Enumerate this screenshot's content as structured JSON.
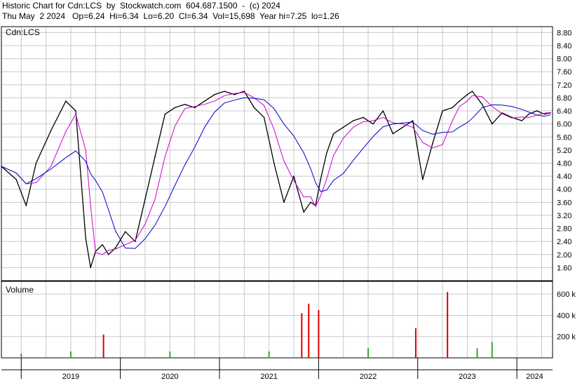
{
  "header": {
    "line1": "Historic Chart for Cdn:LCS  by  Stockwatch.com  604.687.1500  -  (c) 2024",
    "line2": "Thu May  2 2024   Op=6.24  Hi=6.34  Lo=6.20  Cl=6.34  Vol=15,698  Year hi=7.25  lo=1.26"
  },
  "price_panel": {
    "label": "Cdn:LCS",
    "ticks": [
      "8.80",
      "8.40",
      "8.00",
      "7.60",
      "7.20",
      "6.80",
      "6.40",
      "6.00",
      "5.60",
      "5.20",
      "4.80",
      "4.40",
      "4.00",
      "3.60",
      "3.20",
      "2.80",
      "2.40",
      "2.00",
      "1.60"
    ]
  },
  "volume_panel": {
    "label": "Volume",
    "ticks": [
      "600 k",
      "400 k",
      "200 k"
    ]
  },
  "x_axis": {
    "years": [
      "2019",
      "2020",
      "2021",
      "2022",
      "2023",
      "2024"
    ]
  },
  "colors": {
    "price": "#000000",
    "ma_short": "#cc00cc",
    "ma_long": "#0000cc",
    "vol_up": "#33aa33",
    "vol_down": "#dd0000",
    "grid": "#c8c8c8"
  },
  "chart_data": {
    "type": "line",
    "title": "Historic Chart for Cdn:LCS",
    "xlabel": "",
    "ylabel": "",
    "ylim": [
      1.26,
      8.9
    ],
    "x": [
      2018.8,
      2018.95,
      2019.05,
      2019.15,
      2019.3,
      2019.45,
      2019.55,
      2019.65,
      2019.7,
      2019.75,
      2019.82,
      2019.88,
      2019.95,
      2020.05,
      2020.15,
      2020.25,
      2020.35,
      2020.45,
      2020.55,
      2020.65,
      2020.75,
      2020.85,
      2020.95,
      2021.05,
      2021.15,
      2021.25,
      2021.35,
      2021.45,
      2021.55,
      2021.65,
      2021.75,
      2021.85,
      2021.92,
      2021.97,
      2022.02,
      2022.08,
      2022.15,
      2022.25,
      2022.35,
      2022.45,
      2022.55,
      2022.65,
      2022.75,
      2022.85,
      2022.95,
      2023.05,
      2023.15,
      2023.25,
      2023.35,
      2023.42,
      2023.5,
      2023.55,
      2023.65,
      2023.75,
      2023.85,
      2023.95,
      2024.05,
      2024.12,
      2024.2,
      2024.28,
      2024.34
    ],
    "series": [
      {
        "name": "",
        "values": [
          4.7,
          4.3,
          3.5,
          4.8,
          5.8,
          6.7,
          6.4,
          2.5,
          1.6,
          2.1,
          2.3,
          2.0,
          2.2,
          2.7,
          2.4,
          3.7,
          5.0,
          6.3,
          6.5,
          6.6,
          6.5,
          6.7,
          6.9,
          7.0,
          6.9,
          7.0,
          6.5,
          6.2,
          4.8,
          3.6,
          4.4,
          3.3,
          3.6,
          3.5,
          4.3,
          5.1,
          5.7,
          5.9,
          6.1,
          6.2,
          6.0,
          6.4,
          5.7,
          5.9,
          6.1,
          4.3,
          5.4,
          6.4,
          6.5,
          6.7,
          6.9,
          7.0,
          6.6,
          6.0,
          6.34,
          6.2,
          6.1,
          6.3,
          6.4,
          6.3,
          6.34
        ]
      }
    ],
    "volume": {
      "x": [
        2019.0,
        2019.5,
        2019.83,
        2020.5,
        2021.5,
        2021.83,
        2021.9,
        2022.0,
        2022.5,
        2022.98,
        2023.3,
        2023.6,
        2023.75
      ],
      "values": [
        40,
        60,
        220,
        60,
        60,
        420,
        510,
        450,
        90,
        280,
        620,
        90,
        150
      ]
    }
  }
}
